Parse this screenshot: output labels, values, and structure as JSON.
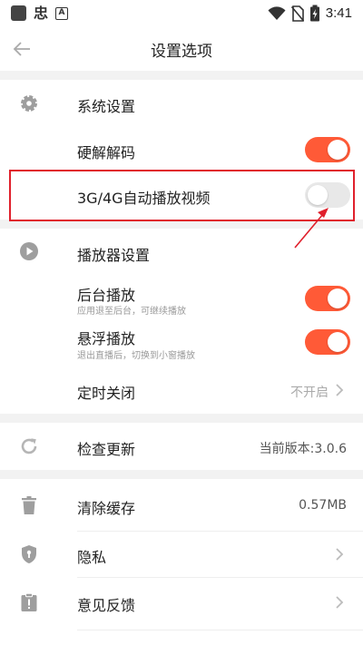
{
  "status_bar": {
    "time": "3:41",
    "app_icon_char": "忠",
    "a_icon_char": "A"
  },
  "header": {
    "title": "设置选项"
  },
  "sections": {
    "system": {
      "header_label": "系统设置",
      "hard_decode": {
        "label": "硬解解码",
        "enabled": true
      },
      "auto_play": {
        "label": "3G/4G自动播放视频",
        "enabled": false
      }
    },
    "player": {
      "header_label": "播放器设置",
      "background_play": {
        "label": "后台播放",
        "subtitle": "应用退至后台，可继续播放",
        "enabled": true
      },
      "float_play": {
        "label": "悬浮播放",
        "subtitle": "退出直播后，切换到小窗播放",
        "enabled": true
      },
      "timer_close": {
        "label": "定时关闭",
        "value": "不开启"
      }
    },
    "update": {
      "label": "检查更新",
      "value": "当前版本:3.0.6"
    },
    "cache": {
      "label": "清除缓存",
      "value": "0.57MB"
    },
    "privacy": {
      "label": "隐私"
    },
    "feedback": {
      "label": "意见反馈"
    }
  },
  "colors": {
    "accent": "#ff5a37",
    "highlight": "#e0202c",
    "icon_gray": "#9e9e9e"
  },
  "icons": [
    "back-arrow-icon",
    "gear-icon",
    "play-circle-icon",
    "refresh-icon",
    "trash-icon",
    "shield-icon",
    "feedback-icon",
    "chevron-right-icon",
    "wifi-icon",
    "no-sim-icon",
    "battery-charging-icon"
  ]
}
